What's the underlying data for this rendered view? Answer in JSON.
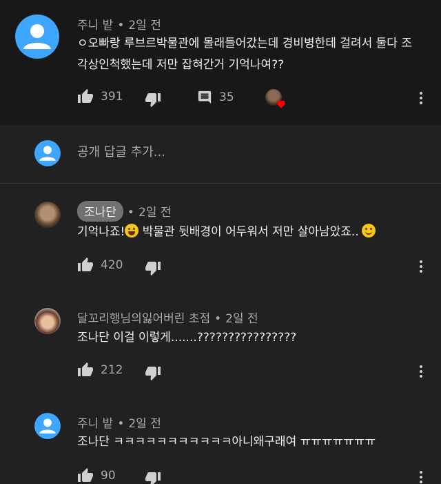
{
  "comment": {
    "author": "주니 밭",
    "time": "2일 전",
    "text_line1": "ㅇ오빠랑 루브르박물관에 몰래들어갔는데 경비병한테 걸려서 둘다 조",
    "text_line2": "각상인척했는데  저만 잡혀간거 기억나여??",
    "likes": "391",
    "replies": "35"
  },
  "reply_box": {
    "placeholder": "공개 답글 추가..."
  },
  "replies": [
    {
      "author": "조나단",
      "time": "2일 전",
      "text_part1": "기억나죠!",
      "text_part2": " 박물관 뒷배경이 어두워서 저만 살아남았죠..",
      "likes": "420"
    },
    {
      "author": "달꼬리행님의잃어버린 초점",
      "time": "2일 전",
      "text": "조나단 이걸 이렇게.......????????????????",
      "likes": "212"
    },
    {
      "author": "주니 밭",
      "time": "2일 전",
      "text": "조나단 ㅋㅋㅋㅋㅋㅋㅋㅋㅋㅋㅋ아니왜구래여 ㅠㅠㅠㅠㅠㅠㅠ",
      "likes": "90"
    }
  ],
  "colors": {
    "background": "#212121",
    "top_background": "#181818",
    "avatar_default": "#3ea6ff",
    "heart": "#ff0000"
  },
  "icons": [
    "thumb-up-icon",
    "thumb-down-icon",
    "comment-icon",
    "more-vert-icon",
    "heart-icon"
  ]
}
